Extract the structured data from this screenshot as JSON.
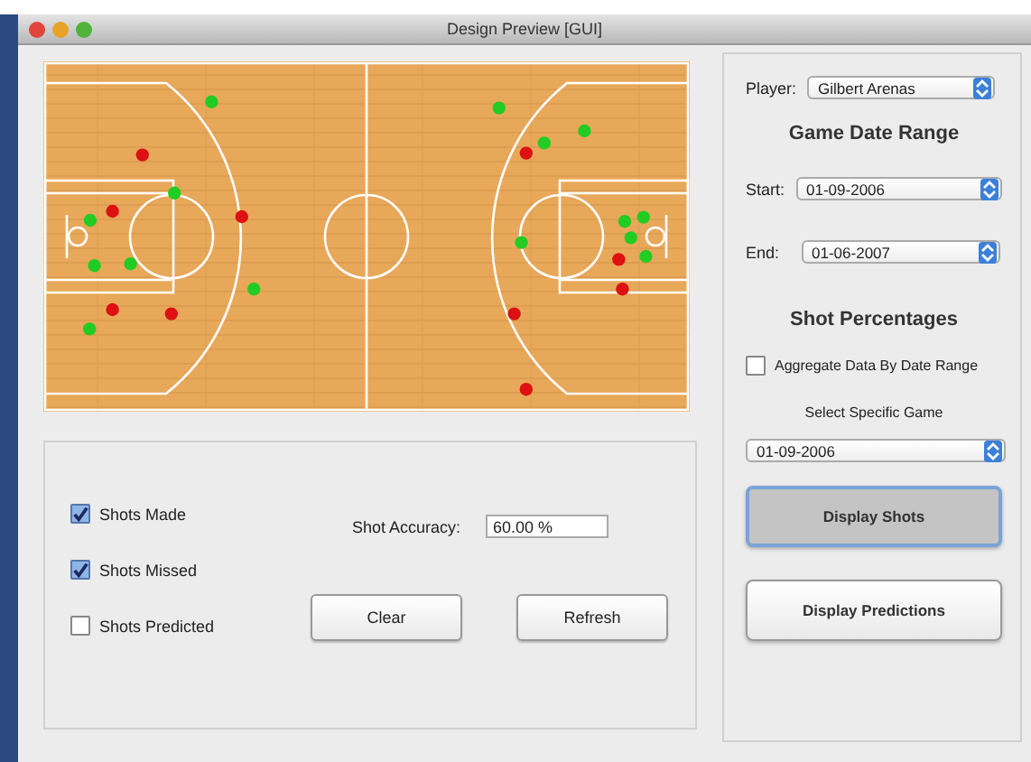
{
  "window": {
    "title": "Design Preview [GUI]"
  },
  "shots": [
    {
      "color": "#22cc22"
    },
    {
      "color": "#dd1111"
    },
    {
      "color": "#22cc22"
    },
    {
      "color": "#dd1111"
    },
    {
      "color": "#22cc22"
    },
    {
      "color": "#dd1111"
    },
    {
      "color": "#22cc22"
    },
    {
      "color": "#22cc22"
    },
    {
      "color": "#22cc22"
    },
    {
      "color": "#dd1111"
    },
    {
      "color": "#dd1111"
    },
    {
      "color": "#22cc22"
    },
    {
      "color": "#22cc22"
    },
    {
      "color": "#22cc22"
    },
    {
      "color": "#dd1111"
    },
    {
      "color": "#22cc22"
    },
    {
      "color": "#22cc22"
    },
    {
      "color": "#22cc22"
    },
    {
      "color": "#22cc22"
    },
    {
      "color": "#22cc22"
    },
    {
      "color": "#22cc22"
    },
    {
      "color": "#dd1111"
    },
    {
      "color": "#dd1111"
    },
    {
      "color": "#dd1111"
    },
    {
      "color": "#dd1111"
    }
  ],
  "filters": [
    {
      "label": "Shots Made",
      "checked": true
    },
    {
      "label": "Shots Missed",
      "checked": true
    },
    {
      "label": "Shots Predicted",
      "checked": false
    }
  ],
  "accuracy": {
    "label": "Shot Accuracy:",
    "value": "60.00 %"
  },
  "actions": [
    "Clear",
    "Refresh"
  ],
  "player": {
    "label": "Player:",
    "value": "Gilbert Arenas"
  },
  "date_range": {
    "heading": "Game Date Range",
    "start_label": "Start:",
    "start": "01-09-2006",
    "end_label": "End:",
    "end": "01-06-2007"
  },
  "percentages": {
    "heading": "Shot Percentages",
    "aggregate": {
      "label": "Aggregate Data By Date Range",
      "checked": false
    },
    "game_label": "Select Specific Game",
    "game": "01-09-2006"
  },
  "buttons": [
    {
      "label": "Display Shots",
      "selected": true
    },
    {
      "label": "Display Predictions",
      "selected": false
    }
  ]
}
